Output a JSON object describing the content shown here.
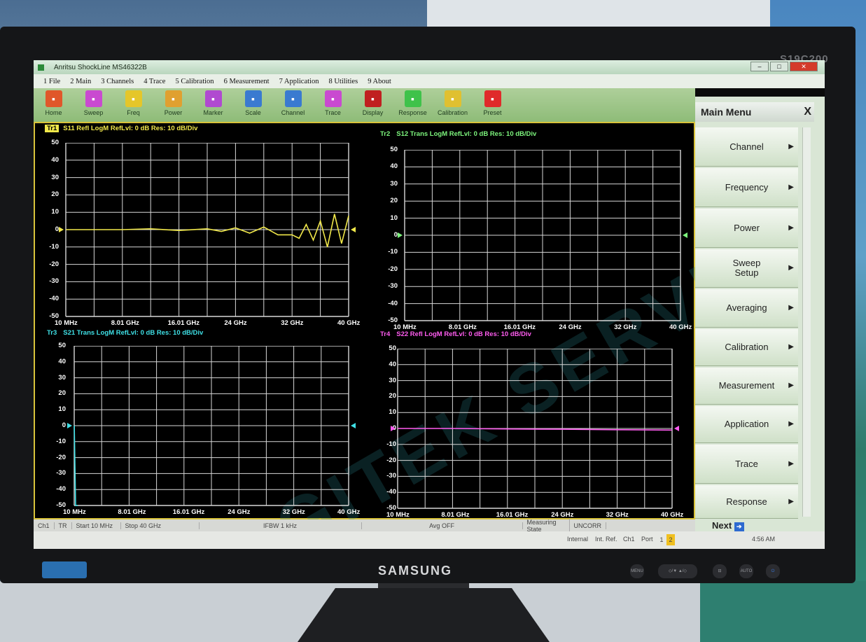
{
  "monitor": {
    "model": "S19C200",
    "brand": "SAMSUNG"
  },
  "window": {
    "title": "Anritsu ShockLine MS46322B"
  },
  "menu": [
    "1 File",
    "2 Main",
    "3 Channels",
    "4 Trace",
    "5 Calibration",
    "6 Measurement",
    "7 Application",
    "8 Utilities",
    "9 About"
  ],
  "toolbar": [
    {
      "label": "Home",
      "icon": "home-icon",
      "color": "#e0572a"
    },
    {
      "label": "Sweep",
      "icon": "sweep-icon",
      "color": "#c94ad0"
    },
    {
      "label": "Freq",
      "icon": "freq-icon",
      "color": "#e5c62a"
    },
    {
      "label": "Power",
      "icon": "power-icon",
      "color": "#e0a030"
    },
    {
      "label": "Marker",
      "icon": "marker-icon",
      "color": "#b04ad0"
    },
    {
      "label": "Scale",
      "icon": "scale-icon",
      "color": "#3a7ad0"
    },
    {
      "label": "Channel",
      "icon": "channel-icon",
      "color": "#3a7ad0"
    },
    {
      "label": "Trace",
      "icon": "trace-icon",
      "color": "#c94ad0"
    },
    {
      "label": "Display",
      "icon": "display-icon",
      "color": "#c02020"
    },
    {
      "label": "Response",
      "icon": "response-icon",
      "color": "#3fc24a"
    },
    {
      "label": "Calibration",
      "icon": "calibration-icon",
      "color": "#e0c030"
    },
    {
      "label": "Preset",
      "icon": "preset-icon",
      "color": "#e02a2a"
    }
  ],
  "traces": [
    {
      "id": "Tr1",
      "header": "S11 Refl LogM RefLvl: 0  dB Res: 10  dB/Div",
      "color": "#f1e84a",
      "active": true
    },
    {
      "id": "Tr2",
      "header": "S12 Trans LogM RefLvl: 0  dB Res: 10  dB/Div",
      "color": "#7df57d",
      "active": false
    },
    {
      "id": "Tr3",
      "header": "S21 Trans LogM RefLvl: 0  dB Res: 10  dB/Div",
      "color": "#3fe0e6",
      "active": false
    },
    {
      "id": "Tr4",
      "header": "S22 Refl LogM RefLvl: 0  dB Res: 10  dB/Div",
      "color": "#ff5cf0",
      "active": false
    }
  ],
  "axis": {
    "y_ticks": [
      "50",
      "40",
      "30",
      "20",
      "10",
      "0",
      "-10",
      "-20",
      "-30",
      "-40",
      "-50"
    ],
    "x_ticks": [
      "10 MHz",
      "8.01 GHz",
      "16.01 GHz",
      "24 GHz",
      "32 GHz",
      "40 GHz"
    ]
  },
  "chart_data": [
    {
      "type": "line",
      "title": "S11 Refl LogM",
      "x_unit": "GHz",
      "ylim": [
        -50,
        50
      ],
      "series": [
        {
          "x": [
            0.01,
            4,
            8,
            12,
            16,
            20,
            22,
            24,
            26,
            28,
            30,
            32,
            33,
            34,
            35,
            36,
            37,
            38,
            39,
            40
          ],
          "values": [
            0,
            0,
            0,
            0.5,
            -0.5,
            0.5,
            -1,
            1,
            -2,
            1.5,
            -3,
            -3,
            -5,
            3,
            -6,
            5,
            -10,
            9,
            -8,
            8
          ]
        }
      ]
    },
    {
      "type": "line",
      "title": "S12 Trans LogM",
      "x_unit": "GHz",
      "ylim": [
        -50,
        50
      ],
      "series": []
    },
    {
      "type": "line",
      "title": "S21 Trans LogM",
      "x_unit": "GHz",
      "ylim": [
        -50,
        50
      ],
      "series": [
        {
          "x": [
            0.01,
            0.2,
            0.5
          ],
          "values": [
            0,
            -50,
            -50
          ]
        }
      ]
    },
    {
      "type": "line",
      "title": "S22 Refl LogM",
      "x_unit": "GHz",
      "ylim": [
        -50,
        50
      ],
      "series": [
        {
          "x": [
            0.01,
            8,
            16,
            24,
            32,
            40
          ],
          "values": [
            0,
            0,
            -0.3,
            -0.5,
            -0.8,
            -1
          ]
        }
      ]
    }
  ],
  "status": {
    "ch": "Ch1",
    "tr": "TR",
    "start": "Start 10 MHz",
    "stop": "Stop 40 GHz",
    "ifbw": "IFBW 1 kHz",
    "avg": "Avg OFF",
    "meas_state": "Measuring State",
    "uncorr": "UNCORR"
  },
  "bottom": {
    "internal": "Internal",
    "intref": "Int. Ref.",
    "ch": "Ch1",
    "port": "Port",
    "p1": "1",
    "p2": "2",
    "time": "4:56 AM"
  },
  "sidemenu": {
    "title": "Main Menu",
    "items": [
      "Channel",
      "Frequency",
      "Power",
      "Sweep Setup",
      "Averaging",
      "Calibration",
      "Measurement",
      "Application",
      "Trace",
      "Response"
    ],
    "next": "Next"
  },
  "watermark": "AGITEK SERVICE"
}
